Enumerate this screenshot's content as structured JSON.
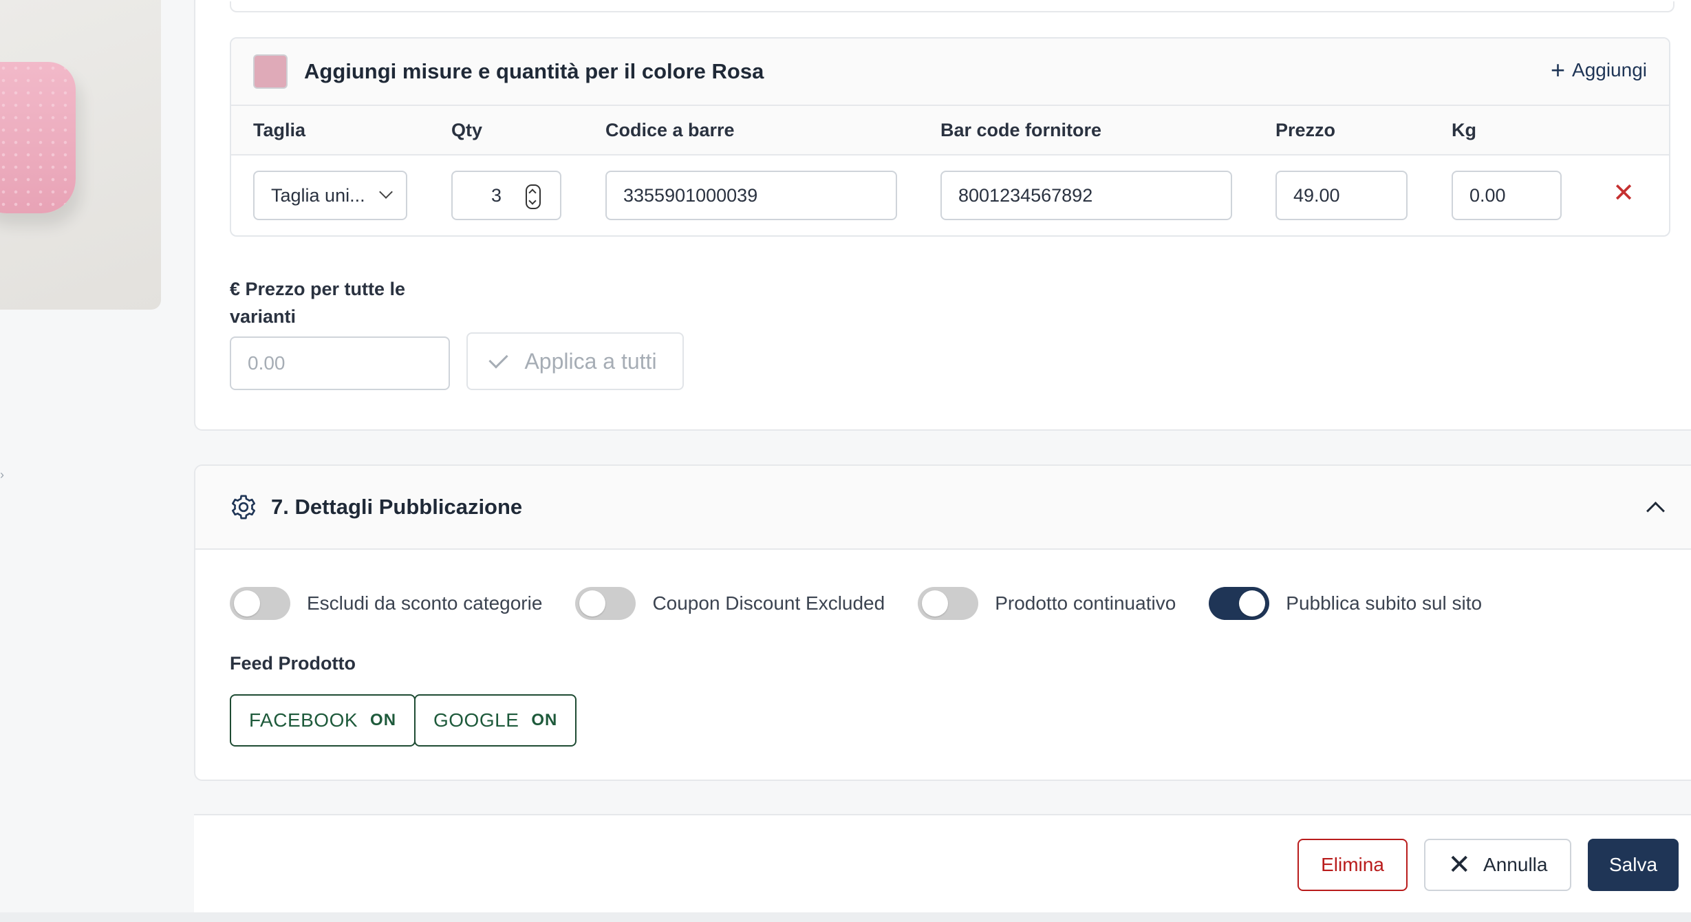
{
  "variant": {
    "title": "Aggiungi misure e quantità per il colore Rosa",
    "swatch_color": "#dfaab8",
    "add_label": "Aggiungi",
    "columns": [
      "Taglia",
      "Qty",
      "Codice a barre",
      "Bar code fornitore",
      "Prezzo",
      "Kg"
    ],
    "row": {
      "size": "Taglia uni...",
      "qty": "3",
      "barcode": "3355901000039",
      "supplier_barcode": "8001234567892",
      "price": "49.00",
      "kg": "0.00"
    }
  },
  "price_all": {
    "label": "€ Prezzo per tutte le varianti",
    "placeholder": "0.00",
    "apply_label": "Applica a tutti"
  },
  "section7": {
    "title": "7. Dettagli Pubblicazione",
    "toggles": [
      {
        "label": "Escludi da sconto categorie",
        "on": false
      },
      {
        "label": "Coupon Discount Excluded",
        "on": false
      },
      {
        "label": "Prodotto continuativo",
        "on": false
      },
      {
        "label": "Pubblica subito sul sito",
        "on": true
      }
    ],
    "feed_label": "Feed Prodotto",
    "feeds": [
      {
        "name": "FACEBOOK",
        "state": "ON"
      },
      {
        "name": "GOOGLE",
        "state": "ON"
      }
    ]
  },
  "footer": {
    "delete_label": "Elimina",
    "cancel_label": "Annulla",
    "save_label": "Salva"
  },
  "colors": {
    "primary": "#1f3556",
    "danger": "#b91c1c",
    "feed_green": "#1e5a3b"
  }
}
